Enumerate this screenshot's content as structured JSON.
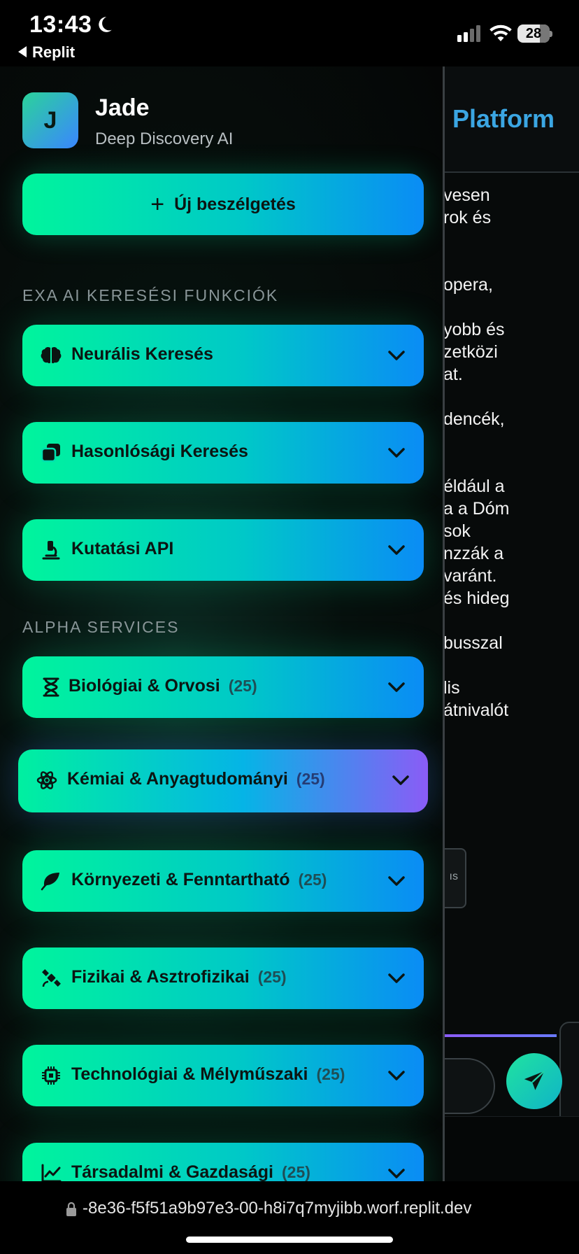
{
  "status_bar": {
    "time": "13:43",
    "back_app": "Replit",
    "battery": "28"
  },
  "main": {
    "title": "Platform",
    "text_lines": [
      "vesen",
      "rok és",
      "",
      "",
      "opera,",
      "",
      "yobb és",
      "zetközi",
      "at.",
      "",
      "dencék,",
      "",
      "",
      "éldául a",
      "a a Dóm",
      "sok",
      "nzzák a",
      "varánt.",
      "és hideg",
      "",
      "busszal",
      "",
      "lis",
      "átnivalót"
    ],
    "chip_text": "ıs"
  },
  "drawer": {
    "avatar_letter": "J",
    "user_name": "Jade",
    "user_sub": "Deep Discovery AI",
    "new_chat": {
      "plus": "+",
      "label": "Új beszélgetés"
    },
    "section_exa": "EXA AI KERESÉSI FUNKCIÓK",
    "exa_items": [
      {
        "label": "Neurális Keresés",
        "icon": "brain-icon"
      },
      {
        "label": "Hasonlósági Keresés",
        "icon": "copy-icon"
      },
      {
        "label": "Kutatási API",
        "icon": "microscope-icon"
      }
    ],
    "section_alpha": "ALPHA SERVICES",
    "alpha_items": [
      {
        "label": "Biológiai & Orvosi",
        "count": "(25)",
        "icon": "hourglass-icon"
      },
      {
        "label": "Kémiai & Anyagtudományi",
        "count": "(25)",
        "icon": "atom-icon",
        "active": true
      },
      {
        "label": "Környezeti & Fenntartható",
        "count": "(25)",
        "icon": "leaf-icon"
      },
      {
        "label": "Fizikai & Asztrofizikai",
        "count": "(25)",
        "icon": "satellite-icon"
      },
      {
        "label": "Technológiai & Mélyműszaki",
        "count": "(25)",
        "icon": "chip-icon"
      },
      {
        "label": "Társadalmi & Gazdasági",
        "count": "(25)",
        "icon": "chart-line-icon"
      }
    ]
  },
  "browser": {
    "url": "-8e36-f5f51a9b97e3-00-h8i7q7myjibb.worf.replit.dev"
  },
  "colors": {
    "accent_start": "#00f59c",
    "accent_end": "#0a8cf5",
    "active_end": "#8a5cf6",
    "title_blue": "#3ba6e3"
  }
}
